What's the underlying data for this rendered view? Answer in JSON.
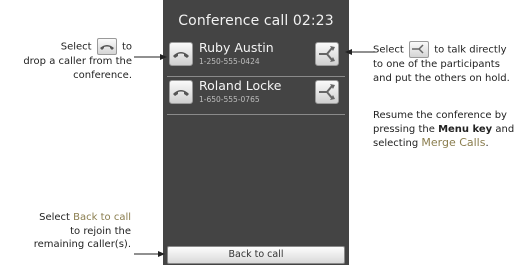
{
  "call_screen": {
    "title": "Conference call 02:23",
    "participants": [
      {
        "name": "Ruby Austin",
        "number": "1-250-555-0424"
      },
      {
        "name": "Roland Locke",
        "number": "1-650-555-0765"
      }
    ],
    "back_button": "Back to call"
  },
  "annotations": {
    "drop_select": "Select",
    "drop_to": "to",
    "drop_line2": "drop a caller from the",
    "drop_line3": "conference.",
    "private_select": "Select",
    "private_to": "to talk directly",
    "private_line2": "to one of the participants",
    "private_line3": "and put the others on hold.",
    "resume_line1": "Resume the conference by",
    "resume_pressing": "pressing the",
    "resume_menu_key": "Menu key",
    "resume_and": "and",
    "resume_selecting": "selecting",
    "resume_merge": "Merge Calls",
    "resume_period": ".",
    "back_select": "Select",
    "back_label": "Back to call",
    "back_line2": "to rejoin the",
    "back_line3": "remaining caller(s)."
  },
  "colors": {
    "screen_bg": "#444444",
    "highlight_text": "#8a7d4e"
  },
  "icons": [
    "hang-up-icon",
    "split-call-icon"
  ]
}
